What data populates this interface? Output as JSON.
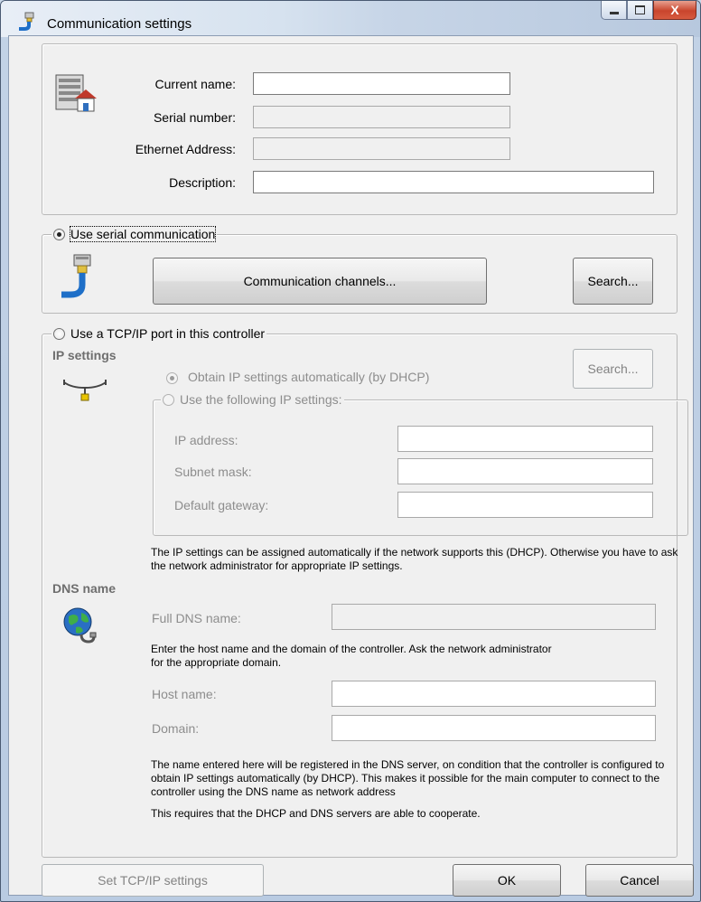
{
  "window": {
    "title": "Communication settings",
    "minimize_glyph": "▁",
    "maximize_glyph": "▢",
    "close_glyph": "X"
  },
  "identity": {
    "current_name_label": "Current name:",
    "current_name_value": "",
    "serial_number_label": "Serial number:",
    "serial_number_value": "",
    "ethernet_label": "Ethernet Address:",
    "ethernet_value": "",
    "description_label": "Description:",
    "description_value": ""
  },
  "serial": {
    "radio_label": "Use serial communication",
    "selected": true,
    "channels_button": "Communication channels...",
    "search_button": "Search..."
  },
  "tcpip": {
    "radio_label": "Use a TCP/IP port in this controller",
    "selected": false,
    "ip_settings_heading": "IP settings",
    "dhcp_radio_label": "Obtain IP settings automatically (by DHCP)",
    "static_radio_label": "Use the following IP settings:",
    "search_button": "Search...",
    "ip_address_label": "IP address:",
    "ip_address_value": "",
    "subnet_mask_label": "Subnet mask:",
    "subnet_mask_value": "",
    "gateway_label": "Default gateway:",
    "gateway_value": "",
    "ip_note": "The IP settings can be assigned automatically if the network supports this (DHCP). Otherwise you have to ask the network administrator for appropriate IP settings.",
    "dns_heading": "DNS name",
    "full_dns_label": "Full DNS name:",
    "full_dns_value": "",
    "dns_note": "Enter the host name and the domain of the controller. Ask the network administrator for the appropriate domain.",
    "host_name_label": "Host name:",
    "host_name_value": "",
    "domain_label": "Domain:",
    "domain_value": "",
    "register_note": "The name entered here will be registered in the DNS server, on condition that the controller is configured to obtain IP settings automatically (by DHCP). This makes it possible for the main computer to connect to the controller using the DNS name as network address",
    "cooperate_note": "This requires that the DHCP and DNS servers are able to cooperate."
  },
  "footer": {
    "set_tcpip_button": "Set TCP/IP settings",
    "ok_button": "OK",
    "cancel_button": "Cancel"
  },
  "icons": {
    "title": "serial-cable-icon",
    "controller": "controller-home-icon",
    "serial": "serial-port-icon",
    "network": "network-tap-icon",
    "dns": "globe-network-icon"
  }
}
